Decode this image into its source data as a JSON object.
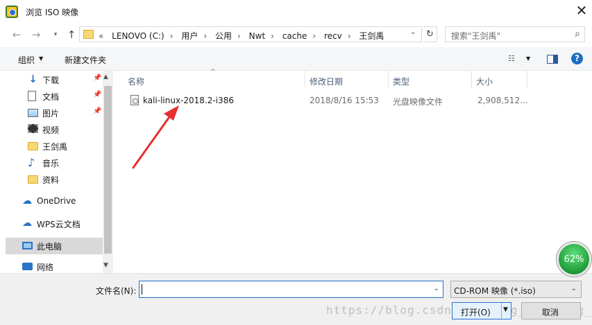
{
  "window": {
    "title": "浏览 ISO 映像",
    "close": "✕"
  },
  "nav": {
    "breadcrumb_prefix": "«",
    "breadcrumbs": [
      "LENOVO (C:)",
      "用户",
      "公用",
      "Nwt",
      "cache",
      "recv",
      "王剑禹"
    ],
    "search_placeholder": "搜索\"王剑禹\""
  },
  "toolbar": {
    "organize": "组织",
    "new_folder": "新建文件夹"
  },
  "sidebar": {
    "items": [
      {
        "label": "下载",
        "icon": "download-icon",
        "pinned": true
      },
      {
        "label": "文档",
        "icon": "document-icon",
        "pinned": true
      },
      {
        "label": "图片",
        "icon": "pictures-icon",
        "pinned": true
      },
      {
        "label": "视频",
        "icon": "video-icon",
        "pinned": false
      },
      {
        "label": "王剑禹",
        "icon": "folder-icon",
        "pinned": false
      },
      {
        "label": "音乐",
        "icon": "music-icon",
        "pinned": false
      },
      {
        "label": "资料",
        "icon": "folder-icon",
        "pinned": false
      },
      {
        "label": "OneDrive",
        "icon": "onedrive-icon",
        "pinned": false
      },
      {
        "label": "WPS云文档",
        "icon": "wps-cloud-icon",
        "pinned": false
      },
      {
        "label": "此电脑",
        "icon": "this-pc-icon",
        "pinned": false,
        "selected": true
      },
      {
        "label": "网络",
        "icon": "network-icon",
        "pinned": false
      }
    ]
  },
  "file_list": {
    "columns": [
      "名称",
      "修改日期",
      "类型",
      "大小"
    ],
    "rows": [
      {
        "name": "kali-linux-2018.2-i386",
        "modified": "2018/8/16 15:53",
        "type": "光盘映像文件",
        "size": "2,908,512..."
      }
    ]
  },
  "footer": {
    "filename_label": "文件名(N):",
    "filename_value": "",
    "filetype_selected": "CD-ROM 映像 (*.iso)",
    "open_label": "打开(O)",
    "cancel_label": "取消"
  },
  "watermark": "https://blog.csdn.net/Wang_jiandong_927",
  "badge": {
    "percent": "62%",
    "progress": 0.62
  },
  "colors": {
    "accent": "#1e6fc4",
    "arrow": "#e53030",
    "badge": "#1f9a3a"
  }
}
